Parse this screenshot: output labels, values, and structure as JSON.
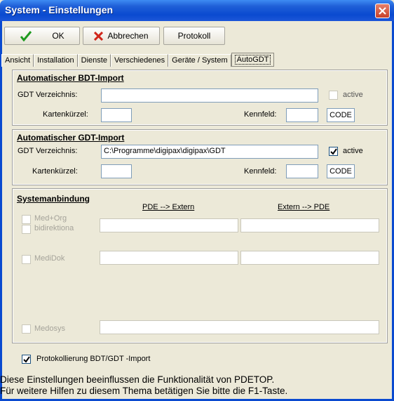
{
  "window": {
    "title": "System - Einstellungen"
  },
  "toolbar": {
    "ok_label": "OK",
    "cancel_label": "Abbrechen",
    "protocol_label": "Protokoll"
  },
  "tabs": [
    {
      "label": "Ansicht"
    },
    {
      "label": "Installation"
    },
    {
      "label": "Dienste"
    },
    {
      "label": "Verschiedenes"
    },
    {
      "label": "Geräte / System"
    },
    {
      "label": "AutoGDT",
      "active": true
    }
  ],
  "bdt_import": {
    "title": "Automatischer BDT-Import",
    "dir_label": "GDT Verzeichnis:",
    "dir_value": "",
    "active_label": "active",
    "active_checked": false,
    "card_label": "Kartenkürzel:",
    "card_value": "",
    "field_label": "Kennfeld:",
    "field_value": "",
    "code_label": "CODE"
  },
  "gdt_import": {
    "title": "Automatischer GDT-Import",
    "dir_label": "GDT Verzeichnis:",
    "dir_value": "C:\\Programme\\digipax\\digipax\\GDT",
    "active_label": "active",
    "active_checked": true,
    "card_label": "Kartenkürzel:",
    "card_value": "",
    "field_label": "Kennfeld:",
    "field_value": "",
    "code_label": "CODE"
  },
  "system_binding": {
    "title": "Systemanbindung",
    "col_left": "PDE --> Extern",
    "col_right": "Extern --> PDE",
    "items": [
      {
        "label": "Med+Org",
        "checked": false
      },
      {
        "label": "bidirektiona",
        "checked": false
      },
      {
        "label": "MediDok",
        "checked": false
      },
      {
        "label": "Medosys",
        "checked": false
      }
    ]
  },
  "logging": {
    "label": "Protokollierung BDT/GDT -Import",
    "checked": true
  },
  "status": {
    "line1": "Diese Einstellungen beeinflussen die Funktionalität von PDETOP.",
    "line2": "Für weitere Hilfen zu diesem Thema betätigen Sie bitte die F1-Taste."
  },
  "colors": {
    "titlebar": "#0a4ad0",
    "window_bg": "#ece9d8",
    "check_green": "#1f9a1f",
    "cancel_red": "#d0261a"
  }
}
